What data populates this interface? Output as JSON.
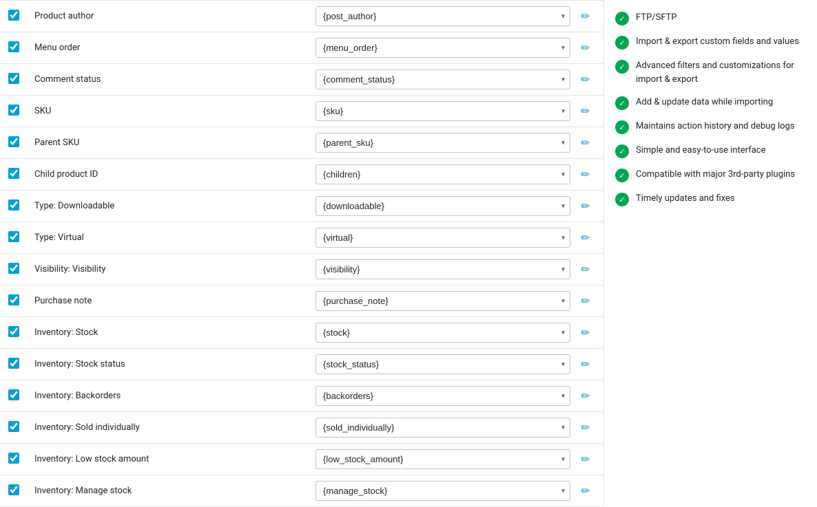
{
  "fields": [
    {
      "label": "Product author",
      "value": "{post_author}",
      "checked": true
    },
    {
      "label": "Menu order",
      "value": "{menu_order}",
      "checked": true
    },
    {
      "label": "Comment status",
      "value": "{comment_status}",
      "checked": true
    },
    {
      "label": "SKU",
      "value": "{sku}",
      "checked": true
    },
    {
      "label": "Parent SKU",
      "value": "{parent_sku}",
      "checked": true
    },
    {
      "label": "Child product ID",
      "value": "{children}",
      "checked": true
    },
    {
      "label": "Type: Downloadable",
      "value": "{downloadable}",
      "checked": true
    },
    {
      "label": "Type: Virtual",
      "value": "{virtual}",
      "checked": true
    },
    {
      "label": "Visibility: Visibility",
      "value": "{visibility}",
      "checked": true
    },
    {
      "label": "Purchase note",
      "value": "{purchase_note}",
      "checked": true
    },
    {
      "label": "Inventory: Stock",
      "value": "{stock}",
      "checked": true
    },
    {
      "label": "Inventory: Stock status",
      "value": "{stock_status}",
      "checked": true
    },
    {
      "label": "Inventory: Backorders",
      "value": "{backorders}",
      "checked": true
    },
    {
      "label": "Inventory: Sold individually",
      "value": "{sold_individually}",
      "checked": true
    },
    {
      "label": "Inventory: Low stock amount",
      "value": "{low_stock_amount}",
      "checked": true
    },
    {
      "label": "Inventory: Manage stock",
      "value": "{manage_stock}",
      "checked": true
    }
  ],
  "sidebar": {
    "features": [
      {
        "text": "FTP/SFTP"
      },
      {
        "text": "Import & export custom fields and values"
      },
      {
        "text": "Advanced filters and customizations for import & export"
      },
      {
        "text": "Add & update data while importing"
      },
      {
        "text": "Maintains action history and debug logs"
      },
      {
        "text": "Simple and easy-to-use interface"
      },
      {
        "text": "Compatible with major 3rd-party plugins"
      },
      {
        "text": "Timely updates and fixes"
      }
    ]
  },
  "icons": {
    "pencil": "✏",
    "check": "✓",
    "chevron": "▾"
  }
}
